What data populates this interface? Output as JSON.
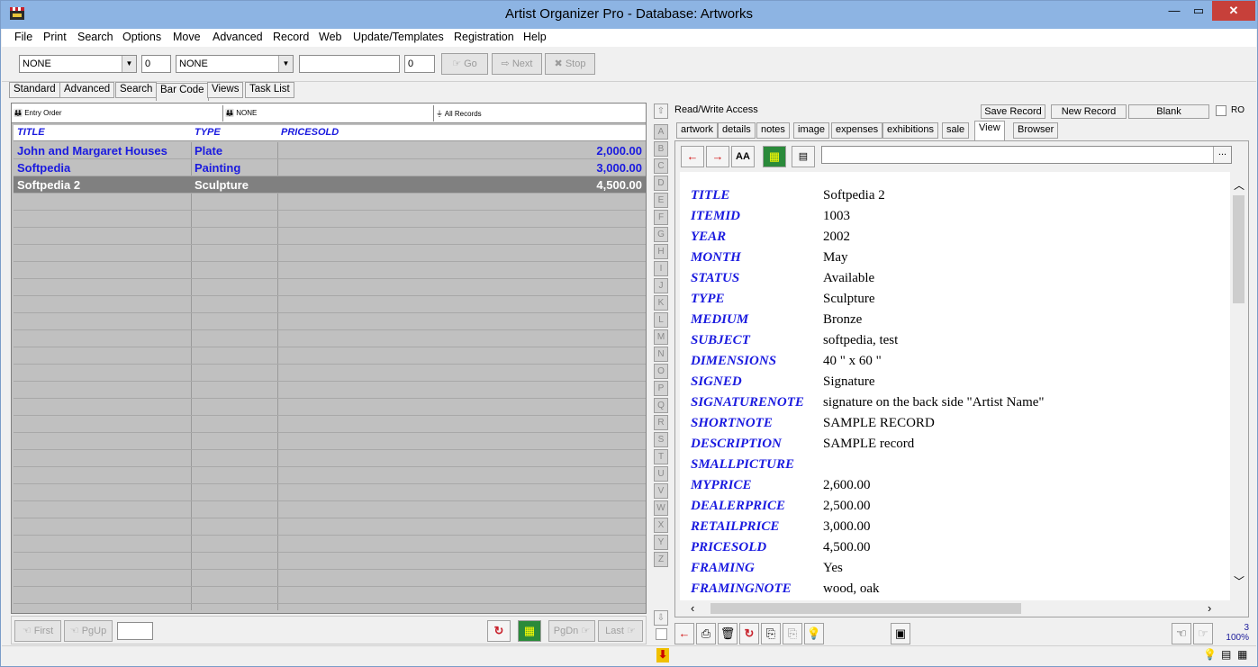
{
  "window": {
    "title": "Artist Organizer Pro - Database: Artworks",
    "minimize": "—",
    "maximize": "▭",
    "close": "✕"
  },
  "menu": [
    "File",
    "Print",
    "Search",
    "Options",
    "Move",
    "Advanced",
    "Record",
    "Web",
    "Update/Templates",
    "Registration",
    "Help"
  ],
  "toolbar": {
    "combo1": "NONE",
    "num1": "0",
    "combo2": "NONE",
    "search_value": "",
    "num2": "0",
    "go": "Go",
    "next": "Next",
    "stop": "Stop"
  },
  "left_tabs": [
    "Standard",
    "Advanced",
    "Search",
    "Bar Code",
    "Views",
    "Task List"
  ],
  "sort_bar": {
    "sort1": "Entry Order",
    "sort2": "NONE",
    "filter": "All Records"
  },
  "grid": {
    "columns": [
      "TITLE",
      "TYPE",
      "PRICESOLD"
    ],
    "rows": [
      {
        "title": "John and Margaret Houses",
        "type": "Plate",
        "pricesold": "2,000.00"
      },
      {
        "title": "Softpedia",
        "type": "Painting",
        "pricesold": "3,000.00"
      },
      {
        "title": "Softpedia 2",
        "type": "Sculpture",
        "pricesold": "4,500.00"
      }
    ]
  },
  "left_footer": {
    "first": "First",
    "pgup": "PgUp",
    "jump_value": "",
    "pgdn": "PgDn",
    "last": "Last"
  },
  "alphabet": [
    "A",
    "B",
    "C",
    "D",
    "E",
    "F",
    "G",
    "H",
    "I",
    "J",
    "K",
    "L",
    "M",
    "N",
    "O",
    "P",
    "Q",
    "R",
    "S",
    "T",
    "U",
    "V",
    "W",
    "X",
    "Y",
    "Z"
  ],
  "right_header": {
    "access": "Read/Write Access",
    "save": "Save Record",
    "new": "New Record",
    "blank": "Blank",
    "ro": "RO"
  },
  "right_tabs": [
    "artwork",
    "details",
    "notes",
    "image",
    "expenses",
    "exhibitions",
    "sale",
    "View",
    "Browser"
  ],
  "view_address": {
    "value": "",
    "ellipsis": "..."
  },
  "record_fields": [
    {
      "label": "TITLE",
      "value": "Softpedia 2"
    },
    {
      "label": "ITEMID",
      "value": "1003"
    },
    {
      "label": "YEAR",
      "value": "2002"
    },
    {
      "label": "MONTH",
      "value": "May"
    },
    {
      "label": "STATUS",
      "value": "Available"
    },
    {
      "label": "TYPE",
      "value": "Sculpture"
    },
    {
      "label": "MEDIUM",
      "value": "Bronze"
    },
    {
      "label": "SUBJECT",
      "value": "softpedia, test"
    },
    {
      "label": "DIMENSIONS",
      "value": "40 \" x 60 \""
    },
    {
      "label": "SIGNED",
      "value": "Signature"
    },
    {
      "label": "SIGNATURENOTE",
      "value": "signature on the back side \"Artist Name\""
    },
    {
      "label": "SHORTNOTE",
      "value": "SAMPLE RECORD"
    },
    {
      "label": "DESCRIPTION",
      "value": "SAMPLE record"
    },
    {
      "label": "SMALLPICTURE",
      "value": ""
    },
    {
      "label": "MYPRICE",
      "value": "2,600.00"
    },
    {
      "label": "DEALERPRICE",
      "value": "2,500.00"
    },
    {
      "label": "RETAILPRICE",
      "value": "3,000.00"
    },
    {
      "label": "PRICESOLD",
      "value": "4,500.00"
    },
    {
      "label": "FRAMING",
      "value": "Yes"
    },
    {
      "label": "FRAMINGNOTE",
      "value": "wood, oak"
    }
  ],
  "right_footer": {
    "record_count": "3",
    "zoom": "100%"
  },
  "colors": {
    "title_bar": "#8db4e3",
    "field_label": "#1a1adf",
    "selected_row": "#808080",
    "grid_bg": "#c0c0c0"
  }
}
